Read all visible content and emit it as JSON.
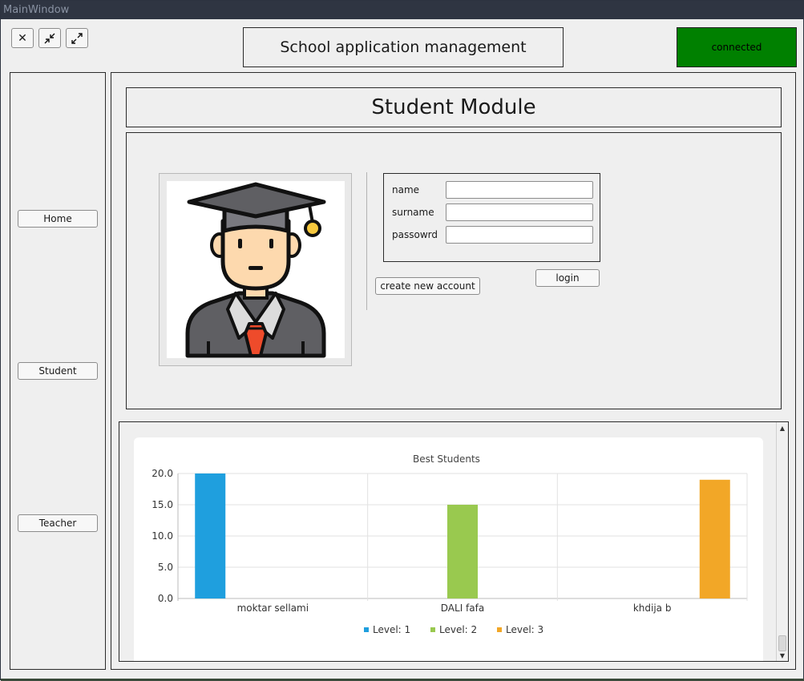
{
  "window": {
    "title": "MainWindow"
  },
  "header": {
    "title": "School application management",
    "status": "connected",
    "status_color": "#008000",
    "buttons": [
      {
        "icon": "close-icon",
        "glyph": "✕"
      },
      {
        "icon": "minimize-icon",
        "glyph": "⤡"
      },
      {
        "icon": "maximize-icon",
        "glyph": "⤢"
      }
    ]
  },
  "sidebar": {
    "items": [
      {
        "label": "Home"
      },
      {
        "label": "Student"
      },
      {
        "label": "Teacher"
      }
    ]
  },
  "module": {
    "title": "Student Module",
    "form": {
      "name_label": "name",
      "name_value": "",
      "surname_label": "surname",
      "surname_value": "",
      "password_label": "passowrd",
      "password_value": "",
      "login_button": "login",
      "create_button": "create new account"
    },
    "avatar_icon": "graduate-student-icon"
  },
  "chart_data": {
    "type": "bar",
    "title": "Best Students",
    "categories": [
      "moktar sellami",
      "DALI fafa",
      "khdija b"
    ],
    "series": [
      {
        "name": "Level: 1",
        "color": "#1f9fde",
        "values": [
          20.0,
          null,
          null
        ]
      },
      {
        "name": "Level: 2",
        "color": "#99c94f",
        "values": [
          null,
          15.0,
          null
        ]
      },
      {
        "name": "Level: 3",
        "color": "#f2a727",
        "values": [
          null,
          null,
          19.0
        ]
      }
    ],
    "ylim": [
      0,
      20
    ],
    "yticks": [
      "20.0",
      "15.0",
      "10.0",
      "5.0",
      "0.0"
    ],
    "xlabel": "",
    "ylabel": "",
    "grid": true,
    "legend": "bottom"
  }
}
